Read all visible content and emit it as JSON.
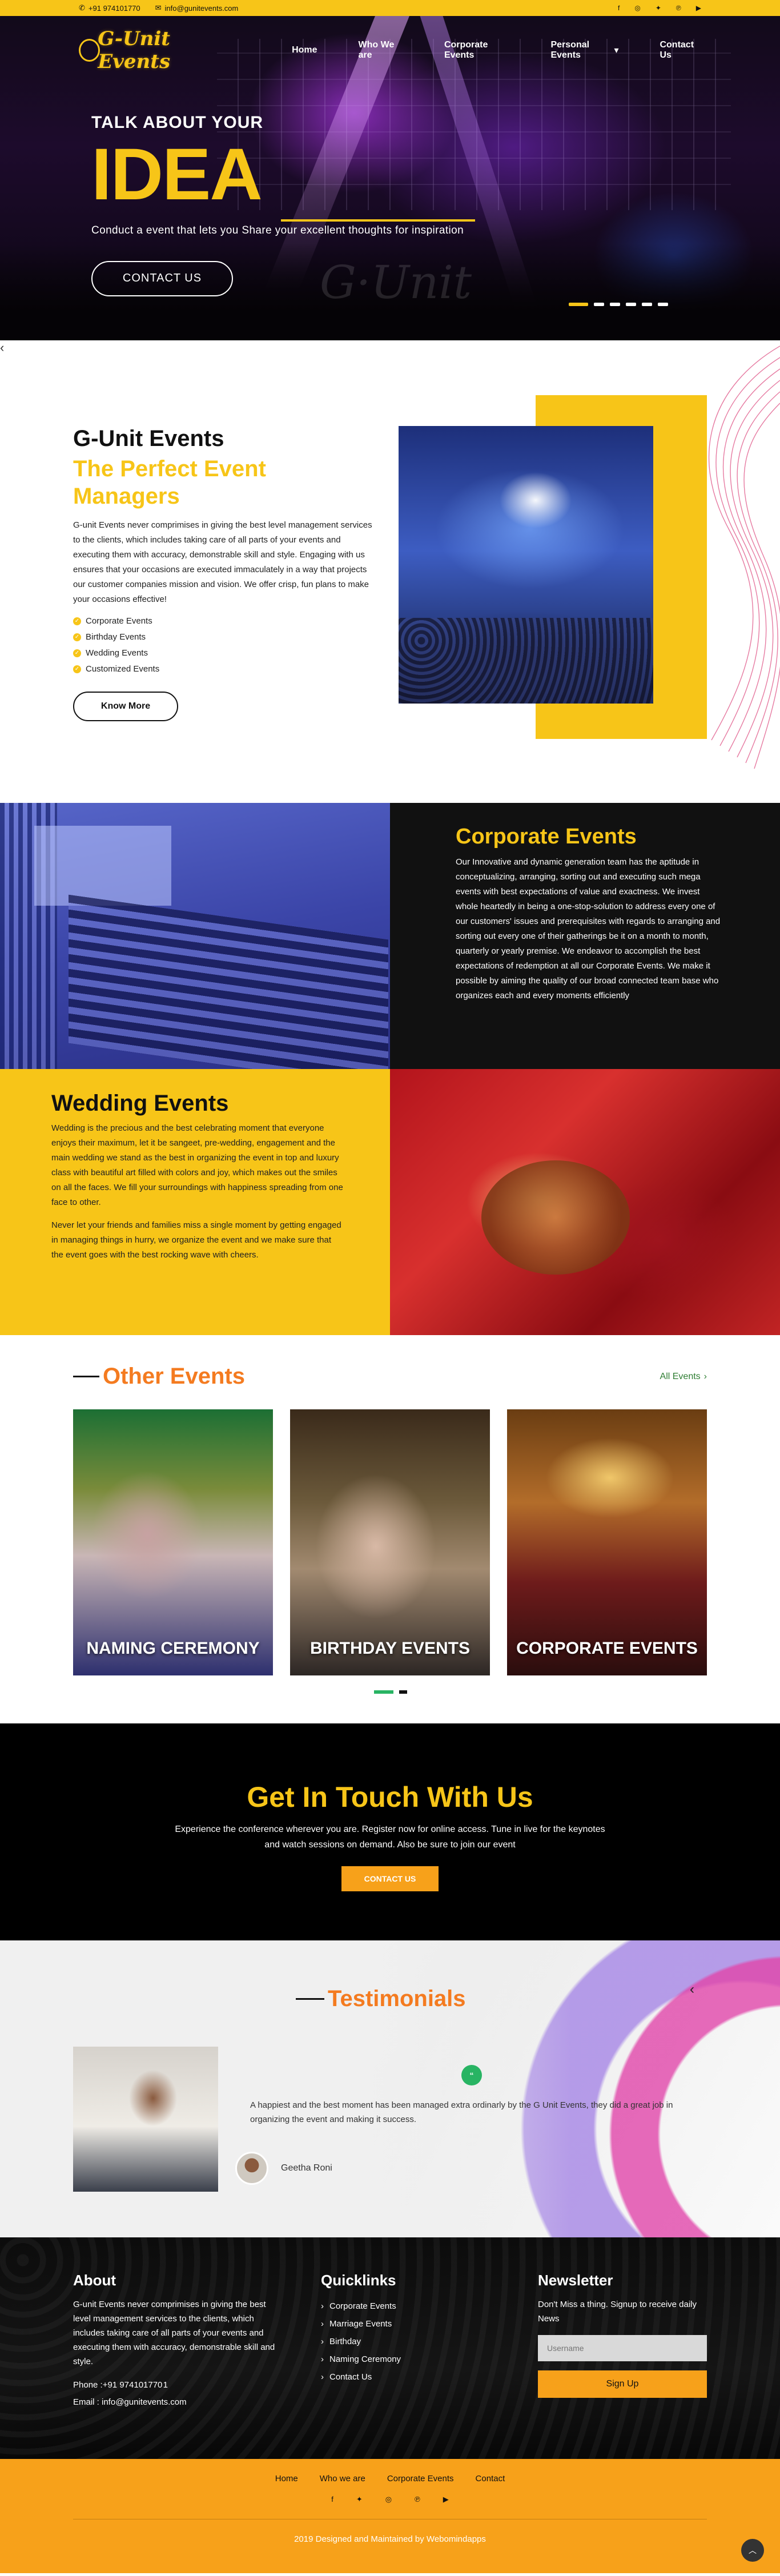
{
  "topbar": {
    "phone": "+91 974101770",
    "email": "info@gunitevents.com",
    "social_icons": [
      "facebook-icon",
      "instagram-icon",
      "twitter-icon",
      "pinterest-icon",
      "youtube-icon"
    ]
  },
  "nav": {
    "logo_text": "G-Unit Events",
    "items": [
      {
        "label": "Home"
      },
      {
        "label": "Who We are"
      },
      {
        "label": "Corporate Events"
      },
      {
        "label": "Personal Events"
      },
      {
        "label": "Contact Us"
      }
    ]
  },
  "hero": {
    "kicker": "TALK ABOUT YOUR",
    "title": "IDEA",
    "subtitle": "Conduct a event that lets you Share your excellent thoughts for inspiration",
    "button": "CONTACT US",
    "slides": 6,
    "active_slide": 1
  },
  "about": {
    "title": "G-Unit Events",
    "subtitle": "The Perfect Event Managers",
    "text": "G-unit Events never comprimises in giving the best level management services to the clients, which includes taking care of all parts of your events and executing them with accuracy, demonstrable skill and style. Engaging with us ensures that your occasions are executed immaculately in a way that projects our customer companies mission and vision. We offer crisp, fun plans to make your occasions effective!",
    "list": [
      "Corporate Events",
      "Birthday Events",
      "Wedding Events",
      "Customized Events"
    ],
    "button": "Know More"
  },
  "corporate": {
    "title": "Corporate Events",
    "text": "Our Innovative and dynamic generation team has the aptitude in conceptualizing, arranging, sorting out and executing such mega events with best expectations of value and exactness. We invest whole heartedly in being a one-stop-solution to address every one of our customers' issues and prerequisites with regards to arranging and sorting out every one of their gatherings be it on a month to month, quarterly or yearly premise. We endeavor to accomplish the best expectations of redemption at all our Corporate Events. We make it possible by aiming the quality of our broad connected team base who organizes each and every moments efficiently"
  },
  "wedding": {
    "title": "Wedding Events",
    "text1": "Wedding is the precious and the best celebrating moment that everyone enjoys their maximum, let it be sangeet, pre-wedding, engagement and the main wedding we stand as the best in organizing the event in top and luxury class with beautiful art filled with colors and joy, which makes out the smiles on all the faces. We fill your surroundings with happiness spreading from one face to other.",
    "text2": "Never let your friends and families miss a single moment by getting engaged in managing things in hurry, we organize the event and we make sure that the event goes with the best rocking wave with cheers."
  },
  "other_events": {
    "title": "Other Events",
    "all_link": "All Events",
    "cards": [
      {
        "label": "NAMING CEREMONY"
      },
      {
        "label": "BIRTHDAY EVENTS"
      },
      {
        "label": "CORPORATE EVENTS"
      }
    ]
  },
  "touch": {
    "title": "Get In Touch With Us",
    "text": "Experience the conference wherever you are. Register now for online access. Tune in live for the keynotes and watch sessions on demand. Also be sure to join our event",
    "button": "CONTACT US"
  },
  "testimonials": {
    "title": "Testimonials",
    "quote": "A happiest and the best moment has been managed extra ordinarly by the G Unit Events, they did a great job in organizing the event and making it success.",
    "author": "Geetha Roni"
  },
  "footer": {
    "about_title": "About",
    "about_text": "G-unit Events never comprimises in giving the best level management services to the clients, which includes taking care of all parts of your events and executing them with accuracy, demonstrable skill and style.",
    "phone": "Phone :+91 974101770 1",
    "email": "Email : info@gunitevents.com",
    "quicklinks_title": "Quicklinks",
    "quicklinks": [
      "Corporate Events",
      "Marriage Events",
      "Birthday",
      "Naming Ceremony",
      "Contact Us"
    ],
    "newsletter_title": "Newsletter",
    "newsletter_text": "Don't Miss a thing. Signup to receive daily News",
    "newsletter_placeholder": "Username",
    "newsletter_button": "Sign Up"
  },
  "bottom": {
    "nav": [
      "Home",
      "Who we are",
      "Corporate Events",
      "Contact"
    ],
    "copyright": "2019 Designed and Maintained by Webomindapps"
  },
  "colors": {
    "brand_yellow": "#f7c518",
    "accent_orange": "#f47b20",
    "footer_orange": "#f7a11a",
    "green": "#28b463"
  }
}
